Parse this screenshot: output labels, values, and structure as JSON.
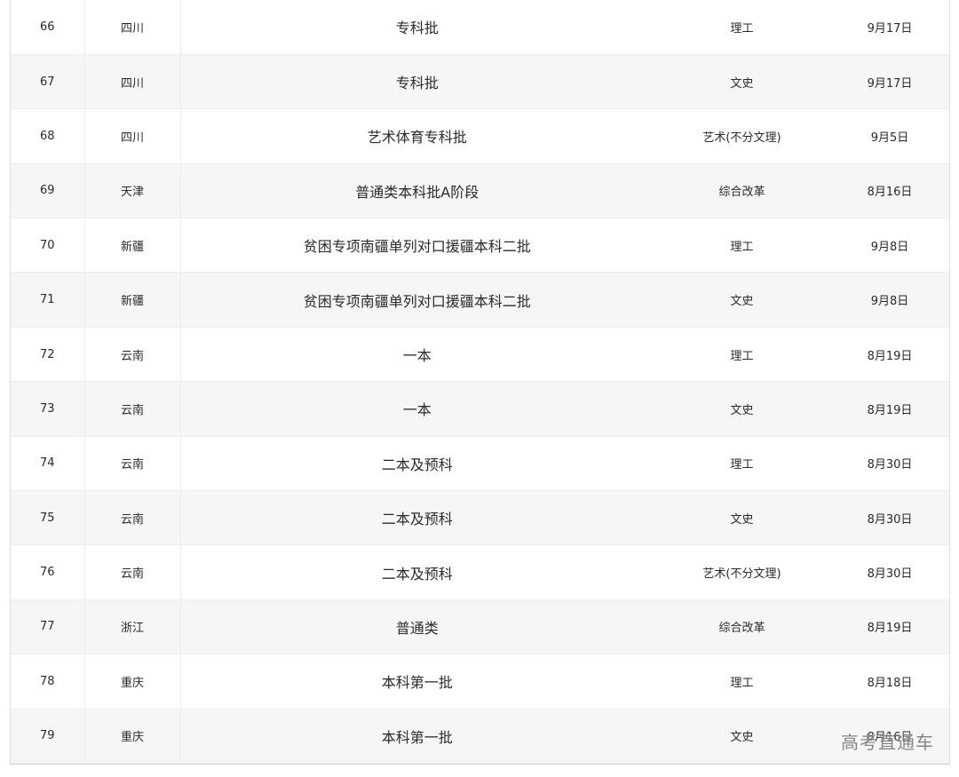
{
  "rows": [
    {
      "no": "66",
      "province": "四川",
      "batch": "专科批",
      "type": "理工",
      "date": "9月17日"
    },
    {
      "no": "67",
      "province": "四川",
      "batch": "专科批",
      "type": "文史",
      "date": "9月17日"
    },
    {
      "no": "68",
      "province": "四川",
      "batch": "艺术体育专科批",
      "type": "艺术(不分文理)",
      "date": "9月5日"
    },
    {
      "no": "69",
      "province": "天津",
      "batch": "普通类本科批A阶段",
      "type": "综合改革",
      "date": "8月16日"
    },
    {
      "no": "70",
      "province": "新疆",
      "batch": "贫困专项南疆单列对口援疆本科二批",
      "type": "理工",
      "date": "9月8日"
    },
    {
      "no": "71",
      "province": "新疆",
      "batch": "贫困专项南疆单列对口援疆本科二批",
      "type": "文史",
      "date": "9月8日"
    },
    {
      "no": "72",
      "province": "云南",
      "batch": "一本",
      "type": "理工",
      "date": "8月19日"
    },
    {
      "no": "73",
      "province": "云南",
      "batch": "一本",
      "type": "文史",
      "date": "8月19日"
    },
    {
      "no": "74",
      "province": "云南",
      "batch": "二本及预科",
      "type": "理工",
      "date": "8月30日"
    },
    {
      "no": "75",
      "province": "云南",
      "batch": "二本及预科",
      "type": "文史",
      "date": "8月30日"
    },
    {
      "no": "76",
      "province": "云南",
      "batch": "二本及预科",
      "type": "艺术(不分文理)",
      "date": "8月30日"
    },
    {
      "no": "77",
      "province": "浙江",
      "batch": "普通类",
      "type": "综合改革",
      "date": "8月19日"
    },
    {
      "no": "78",
      "province": "重庆",
      "batch": "本科第一批",
      "type": "理工",
      "date": "8月18日"
    },
    {
      "no": "79",
      "province": "重庆",
      "batch": "本科第一批",
      "type": "文史",
      "date": "8月16日"
    }
  ],
  "watermark": "高考直通车"
}
